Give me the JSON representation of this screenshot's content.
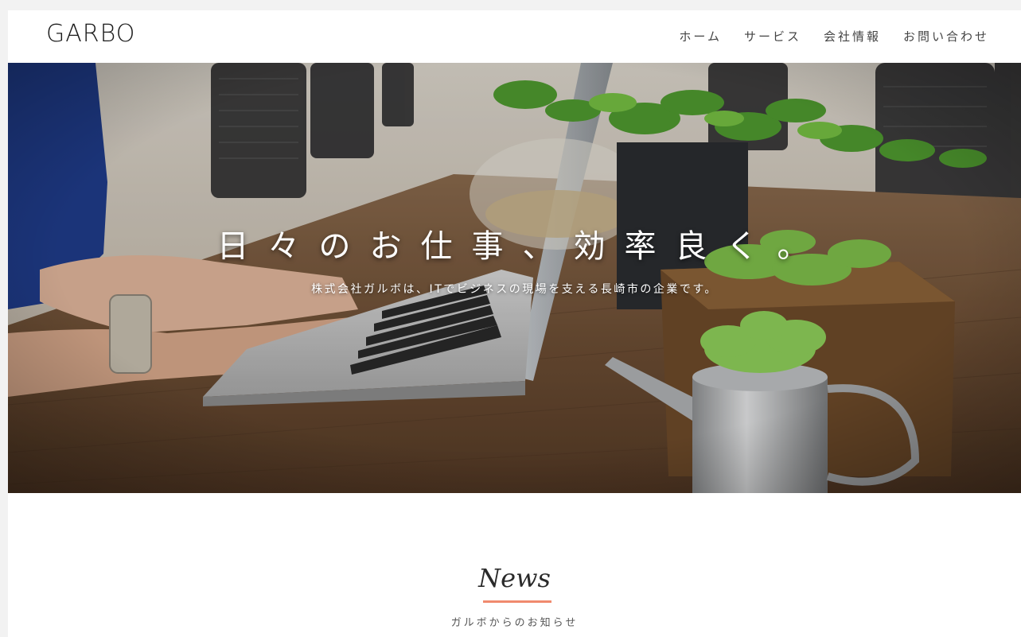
{
  "header": {
    "logo": "GARBO",
    "nav": [
      "ホーム",
      "サービス",
      "会社情報",
      "お問い合わせ"
    ]
  },
  "hero": {
    "headline": "日々のお仕事、効率良く。",
    "subline": "株式会社ガルボは、ITでビジネスの現場を支える長崎市の企業です。"
  },
  "news": {
    "title": "News",
    "subtitle": "ガルボからのお知らせ"
  },
  "colors": {
    "accent": "#f08a6e",
    "text": "#444444"
  }
}
